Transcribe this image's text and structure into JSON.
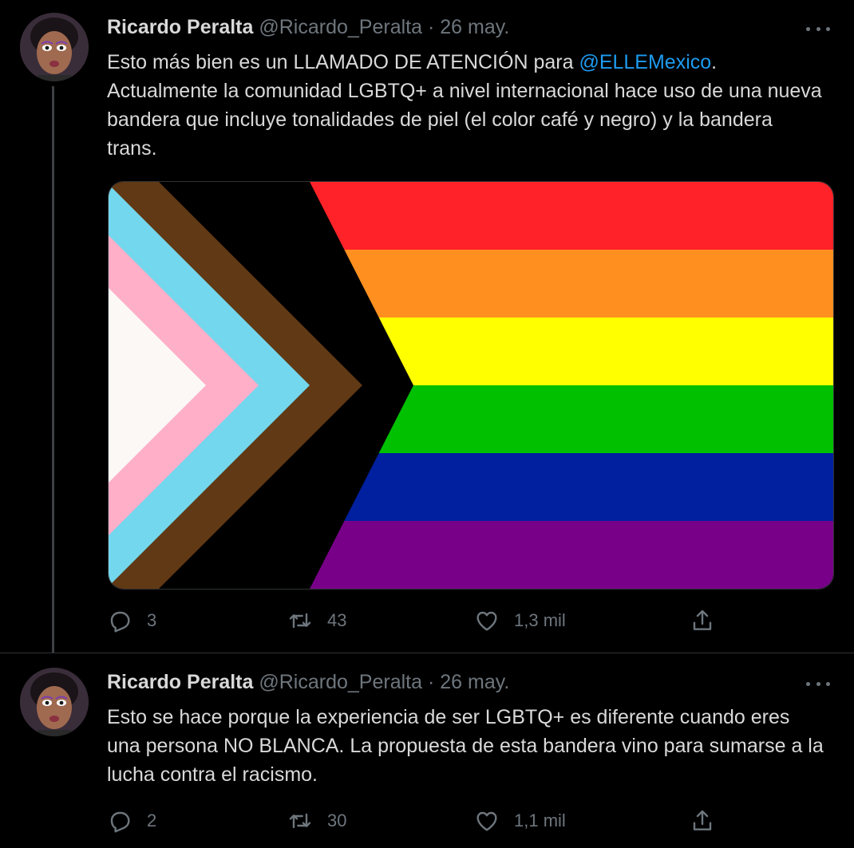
{
  "tweets": [
    {
      "author_name": "Ricardo Peralta",
      "handle": "@Ricardo_Peralta",
      "separator": "·",
      "date": "26 may.",
      "text_before": "Esto más bien es un LLAMADO DE ATENCIÓN para ",
      "mention": "@ELLEMexico",
      "text_after": ". Actualmente la comunidad LGBTQ+ a nivel internacional hace uso de una nueva bandera que incluye tonalidades de piel (el color café y negro) y la bandera trans.",
      "replies": "3",
      "retweets": "43",
      "likes": "1,3 mil"
    },
    {
      "author_name": "Ricardo Peralta",
      "handle": "@Ricardo_Peralta",
      "separator": "·",
      "date": "26 may.",
      "text": "Esto se hace porque la experiencia de ser LGBTQ+ es diferente cuando eres una persona NO BLANCA. La propuesta de esta bandera vino para sumarse a la lucha contra el racismo.",
      "replies": "2",
      "retweets": "30",
      "likes": "1,1 mil"
    }
  ],
  "colors": {
    "background": "#000000",
    "text": "#d9d9d9",
    "muted": "#6e767d",
    "link": "#1d9bf0",
    "flag_stripes": [
      "#ff2228",
      "#ff9020",
      "#ffff00",
      "#00c000",
      "#0020a0",
      "#780088"
    ],
    "flag_chevrons": [
      "#000000",
      "#613915",
      "#73d7ee",
      "#ffafc8",
      "#fbf8f5"
    ]
  },
  "icons": [
    "more-icon",
    "reply-icon",
    "retweet-icon",
    "like-icon",
    "share-icon"
  ]
}
